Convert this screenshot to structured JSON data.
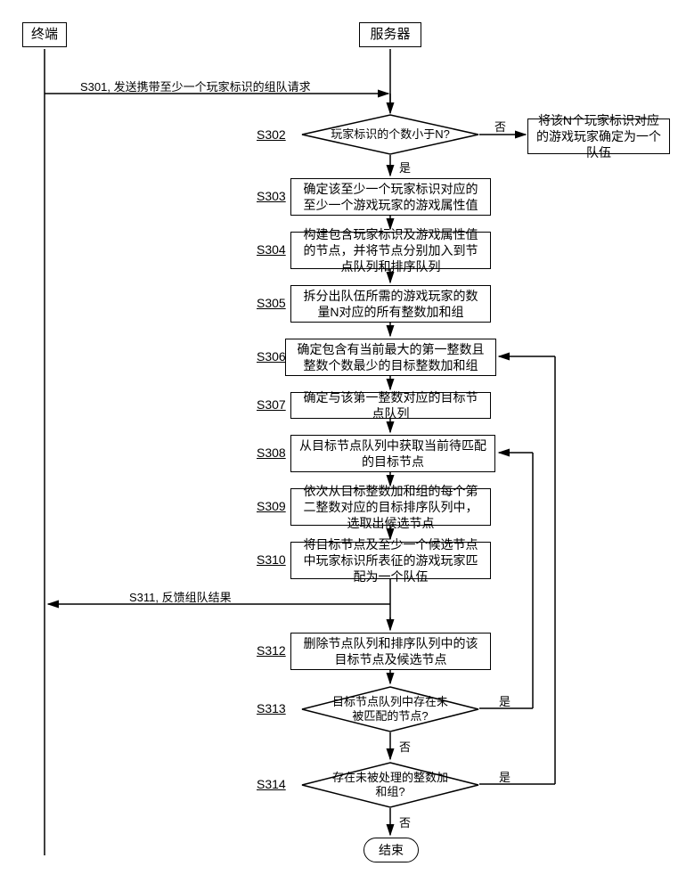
{
  "actors": {
    "terminal": "终端",
    "server": "服务器"
  },
  "messages": {
    "s301": "S301, 发送携带至少一个玩家标识的组队请求",
    "s311": "S311, 反馈组队结果"
  },
  "steps": {
    "s302": {
      "label": "S302",
      "text": "玩家标识的个数小于N?"
    },
    "s302_no": "将该N个玩家标识对应的游戏玩家确定为一个队伍",
    "s303": {
      "label": "S303",
      "text": "确定该至少一个玩家标识对应的至少一个游戏玩家的游戏属性值"
    },
    "s304": {
      "label": "S304",
      "text": "构建包含玩家标识及游戏属性值的节点，并将节点分别加入到节点队列和排序队列"
    },
    "s305": {
      "label": "S305",
      "text": "拆分出队伍所需的游戏玩家的数量N对应的所有整数加和组"
    },
    "s306": {
      "label": "S306",
      "text": "确定包含有当前最大的第一整数且整数个数最少的目标整数加和组"
    },
    "s307": {
      "label": "S307",
      "text": "确定与该第一整数对应的目标节点队列"
    },
    "s308": {
      "label": "S308",
      "text": "从目标节点队列中获取当前待匹配的目标节点"
    },
    "s309": {
      "label": "S309",
      "text": "依次从目标整数加和组的每个第二整数对应的目标排序队列中，选取出候选节点"
    },
    "s310": {
      "label": "S310",
      "text": "将目标节点及至少一个候选节点中玩家标识所表征的游戏玩家匹配为一个队伍"
    },
    "s312": {
      "label": "S312",
      "text": "删除节点队列和排序队列中的该目标节点及候选节点"
    },
    "s313": {
      "label": "S313",
      "text": "目标节点队列中存在未被匹配的节点?"
    },
    "s314": {
      "label": "S314",
      "text": "存在未被处理的整数加和组?"
    }
  },
  "labels": {
    "yes": "是",
    "no": "否",
    "end": "结束"
  }
}
